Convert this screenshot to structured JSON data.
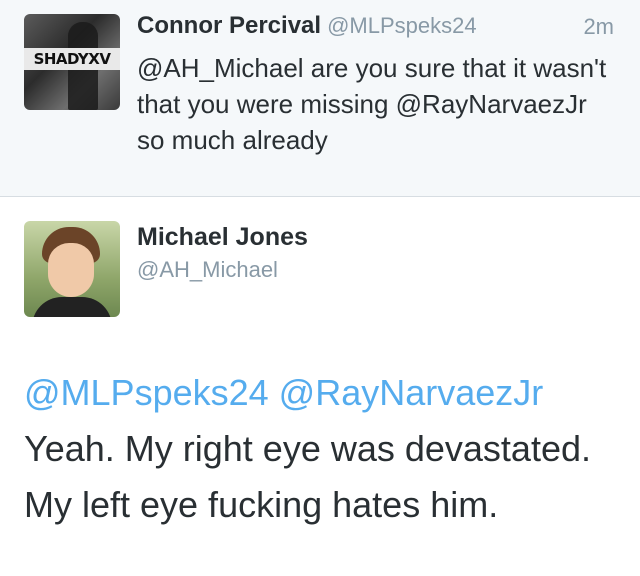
{
  "reply_tweet": {
    "avatar_logo_text": "SHADYXV",
    "name": "Connor Percival",
    "handle": "@MLPspeks24",
    "time": "2m",
    "text": "@AH_Michael are you sure that it wasn't that you were missing @RayNarvaezJr so much already"
  },
  "main_tweet": {
    "name": "Michael Jones",
    "handle": "@AH_Michael",
    "mentions": [
      "@MLPspeks24",
      "@RayNarvaezJr"
    ],
    "text": "Yeah. My right eye was devastated. My left eye fucking hates him."
  }
}
